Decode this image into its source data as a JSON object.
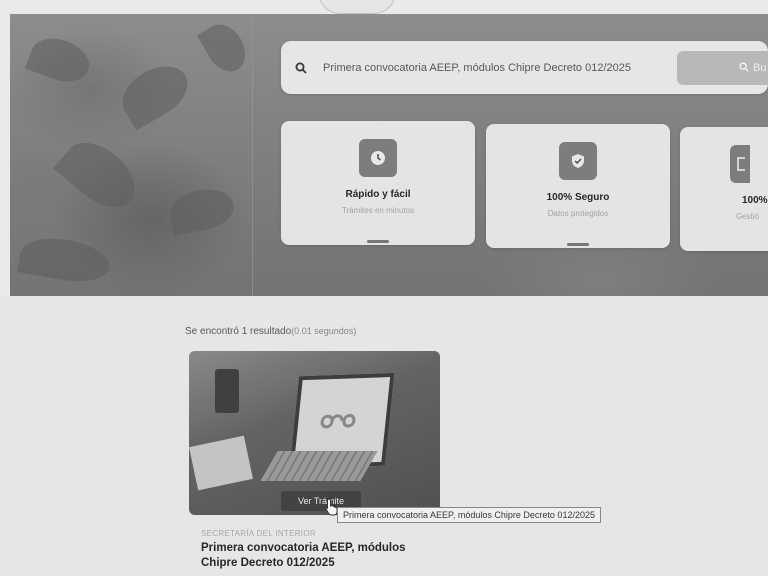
{
  "search": {
    "query": "Primera convocatoria AEEP, módulos Chipre Decreto 012/2025",
    "button_label": "Bu"
  },
  "features": [
    {
      "title": "Rápido y fácil",
      "subtitle": "Trámites en minutos",
      "icon": "clock-icon"
    },
    {
      "title": "100% Seguro",
      "subtitle": "Datos protegidos",
      "icon": "shield-check-icon"
    },
    {
      "title": "100%",
      "subtitle": "Gestió",
      "icon": "document-icon"
    }
  ],
  "results": {
    "count_text": "Se encontró 1 resultado",
    "time_text": "(0.01 segundos)",
    "items": [
      {
        "category": "SECRETARÍA DEL INTERIOR",
        "title": "Primera convocatoria AEEP, módulos Chipre Decreto 012/2025",
        "button_label": "Ver Trámite",
        "tooltip": "Primera convocatoria AEEP, módulos Chipre Decreto 012/2025"
      }
    ]
  },
  "colors": {
    "card_bg": "#e9e9e7",
    "icon_box": "#7d7d7b",
    "page_bg": "#e6e6e4"
  }
}
